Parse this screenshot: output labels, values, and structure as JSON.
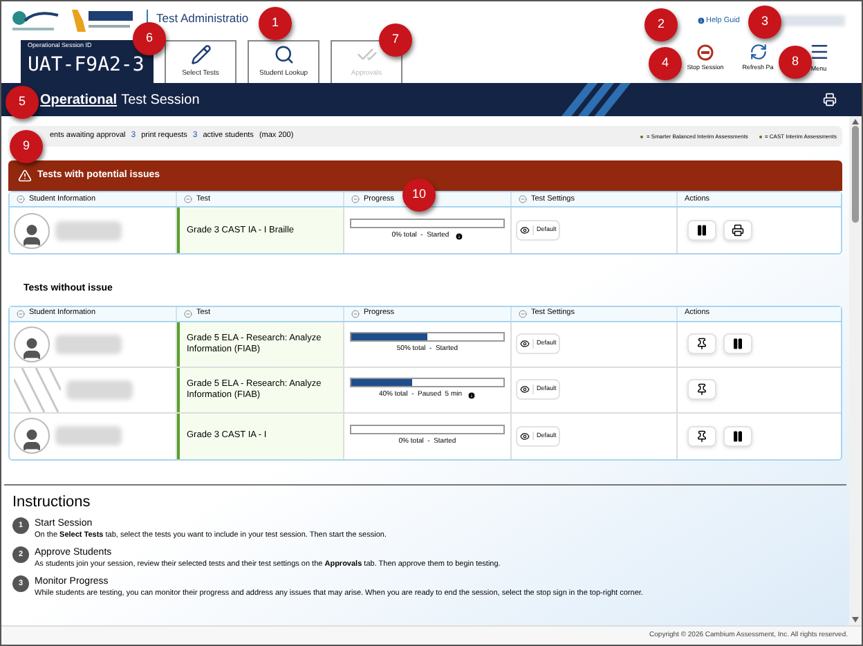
{
  "header": {
    "title": "Test Administratio",
    "help": "Help Guid",
    "session_id_label": "Operational Session ID",
    "session_id": "UAT-F9A2-3",
    "tabs": [
      {
        "label": "Select Tests",
        "disabled": false
      },
      {
        "label": "Student Lookup",
        "disabled": false
      },
      {
        "label": "Approvals",
        "disabled": true
      }
    ],
    "tools": [
      {
        "label": "Stop Session"
      },
      {
        "label": "Refresh Pa"
      },
      {
        "label": "Menu"
      }
    ]
  },
  "banner": {
    "session_type": "Operational",
    "title": "Test Session"
  },
  "summary": {
    "awaiting": "ents awaiting approval",
    "print_count": "3",
    "print_label": "print requests",
    "active_count": "3",
    "active_label": "active students",
    "active_max": "(max 200)",
    "legend": [
      {
        "label": "= Smarter Balanced Interim Assessments",
        "color": "#4a7a1a"
      },
      {
        "label": "= CAST Interim Assessments",
        "color": "#4a7a1a"
      }
    ]
  },
  "issues": {
    "title": "Tests with potential issues",
    "columns": [
      "Student Information",
      "Test",
      "Progress",
      "Test Settings",
      "Actions"
    ],
    "rows": [
      {
        "kind": "person",
        "test": "Grade 3 CAST IA - I Braille",
        "level": 0,
        "progress": "0% total  -  Started",
        "info": true,
        "settings": "Default",
        "actions": [
          {
            "kind": "pause"
          },
          {
            "kind": "print"
          }
        ]
      }
    ]
  },
  "no_issues": {
    "title": "Tests without issue",
    "columns": [
      "Student Information",
      "Test",
      "Progress",
      "Test Settings",
      "Actions"
    ],
    "rows": [
      {
        "kind": "person",
        "test": "Grade 5 ELA - Research: Analyze Information (FIAB)",
        "level": 0.5,
        "progress": "50% total  -  Started",
        "info": false,
        "settings": "Default",
        "actions": [
          {
            "kind": "pin"
          },
          {
            "kind": "pause"
          }
        ]
      },
      {
        "kind": "striped",
        "test": "Grade 5 ELA - Research: Analyze Information (FIAB)",
        "level": 0.4,
        "progress": "40% total  -  Paused  5 min",
        "info": true,
        "settings": "Default",
        "actions": [
          {
            "kind": "pin"
          }
        ]
      },
      {
        "kind": "person",
        "test": "Grade 3 CAST IA - I",
        "level": 0,
        "progress": "0% total  -  Started",
        "info": false,
        "settings": "Default",
        "actions": [
          {
            "kind": "pin"
          },
          {
            "kind": "pause"
          }
        ]
      }
    ]
  },
  "instructions": {
    "title": "Instructions",
    "steps": [
      {
        "number": "1",
        "title": "Start Session",
        "text": "On the **Select Tests** tab, select the tests you want to include in your test session. Then start the session."
      },
      {
        "number": "2",
        "title": "Approve Students",
        "text": "As students join your session, review their selected tests and their test settings on the **Approvals** tab. Then approve them to begin testing."
      },
      {
        "number": "3",
        "title": "Monitor Progress",
        "text": "While students are testing, you can monitor their progress and address any issues that may arise. When you are ready to end the session, select the stop sign in the top-right corner."
      }
    ]
  },
  "footer": "Copyright © 2026 Cambium Assessment, Inc. All rights reserved.",
  "callouts": [
    "1",
    "2",
    "3",
    "4",
    "5",
    "6",
    "7",
    "8",
    "9",
    "10"
  ]
}
